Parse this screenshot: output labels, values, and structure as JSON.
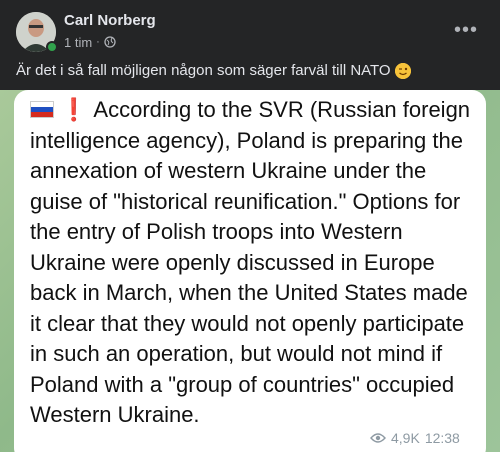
{
  "post": {
    "author": "Carl Norberg",
    "time": "1 tim",
    "caption": "Är det i så fall möjligen någon som säger farväl till NATO",
    "caption_emoji": "winking-face-icon"
  },
  "embedded_message": {
    "flag": "russian-flag-icon",
    "alert": "❗",
    "text": "According to the SVR (Russian foreign intelligence agency), Poland is preparing the annexation of western Ukraine under the guise of \"historical reunification.\" Options for the entry of Polish troops into Western Ukraine were openly discussed in Europe back in March, when the United States made it clear that they would not openly participate in such an operation, but would not mind if Poland with a \"group of countries\" occupied Western Ukraine.",
    "views": "4,9K",
    "time": "12:38"
  },
  "colors": {
    "background": "#242526",
    "text_primary": "#e4e6eb",
    "text_secondary": "#b0b3b8",
    "online": "#31a24c",
    "bubble": "#ffffff",
    "telegram_bg": "#9dc49a"
  }
}
